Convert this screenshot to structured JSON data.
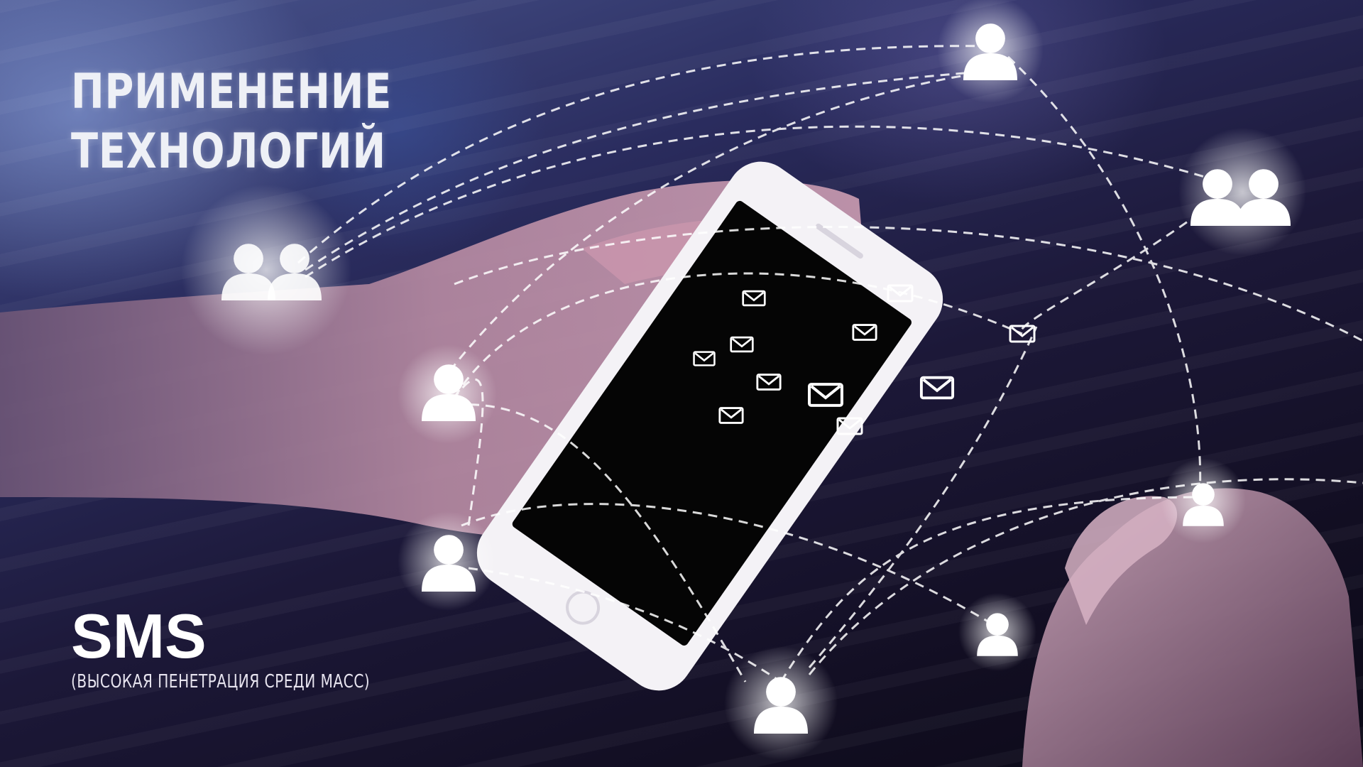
{
  "title": {
    "line1": "ПРИМЕНЕНИЕ",
    "line2": "ТЕХНОЛОГИЙ"
  },
  "heading": "SMS",
  "subheading": "(ВЫСОКАЯ ПЕНЕТРАЦИЯ СРЕДИ МАСС)",
  "icons": {
    "person": "person-icon",
    "group": "people-icon",
    "message": "envelope-icon"
  },
  "colors": {
    "text": "#ffffff",
    "network_line": "#ffffff",
    "phone_body": "#f4f2f6",
    "phone_screen": "#050505"
  }
}
